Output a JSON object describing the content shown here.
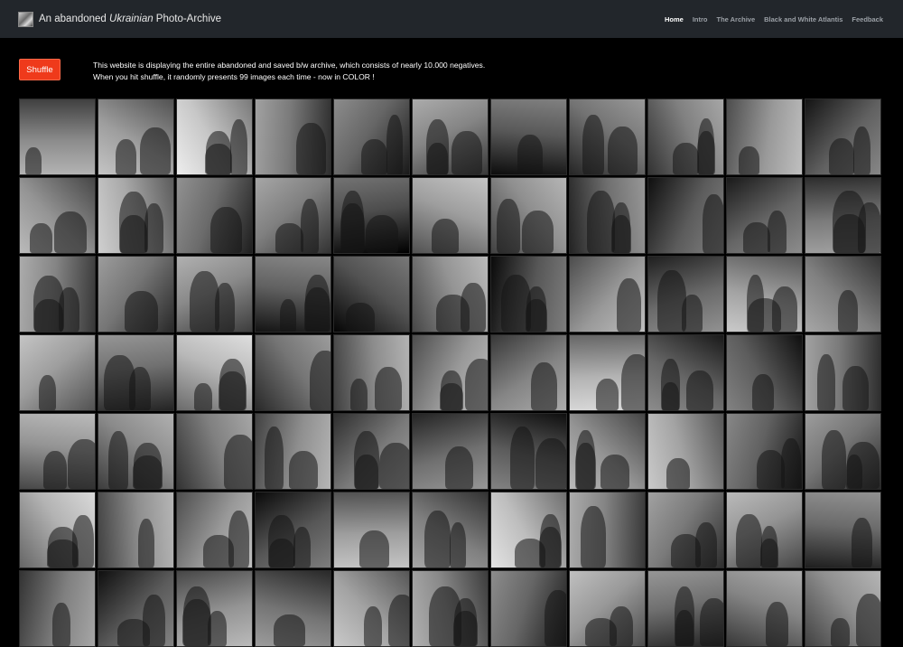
{
  "navbar": {
    "brand_prefix": "An abandoned ",
    "brand_italic": "Ukrainian",
    "brand_suffix": " Photo-Archive",
    "logo_icon": "archive-logo-icon",
    "links": [
      {
        "label": "Home",
        "active": true
      },
      {
        "label": "Intro",
        "active": false
      },
      {
        "label": "The Archive",
        "active": false
      },
      {
        "label": "Black and White Atlantis",
        "active": false
      },
      {
        "label": "Feedback",
        "active": false
      }
    ]
  },
  "shuffle": {
    "label": "Shuffle",
    "color": "#ef3a1b"
  },
  "intro": {
    "line1": "This website is displaying the entire abandoned and saved b/w archive, which consists of nearly 10.000 negatives.",
    "line2": "When you hit shuffle, it randomly presents 99 images each time - now in COLOR !"
  },
  "gallery": {
    "columns": 11,
    "tones": [
      [
        0.55,
        0.62,
        0.78,
        0.48,
        0.4,
        0.52,
        0.35,
        0.45,
        0.5,
        0.6,
        0.38
      ],
      [
        0.58,
        0.66,
        0.42,
        0.5,
        0.3,
        0.62,
        0.56,
        0.44,
        0.36,
        0.4,
        0.48
      ],
      [
        0.52,
        0.46,
        0.54,
        0.38,
        0.32,
        0.58,
        0.34,
        0.6,
        0.42,
        0.64,
        0.5
      ],
      [
        0.62,
        0.44,
        0.72,
        0.46,
        0.55,
        0.6,
        0.52,
        0.7,
        0.4,
        0.36,
        0.48
      ],
      [
        0.58,
        0.54,
        0.5,
        0.56,
        0.48,
        0.44,
        0.36,
        0.58,
        0.64,
        0.38,
        0.46
      ],
      [
        0.7,
        0.56,
        0.6,
        0.34,
        0.62,
        0.5,
        0.74,
        0.52,
        0.48,
        0.58,
        0.42
      ],
      [
        0.5,
        0.36,
        0.58,
        0.46,
        0.64,
        0.54,
        0.4,
        0.6,
        0.44,
        0.52,
        0.56
      ]
    ]
  }
}
